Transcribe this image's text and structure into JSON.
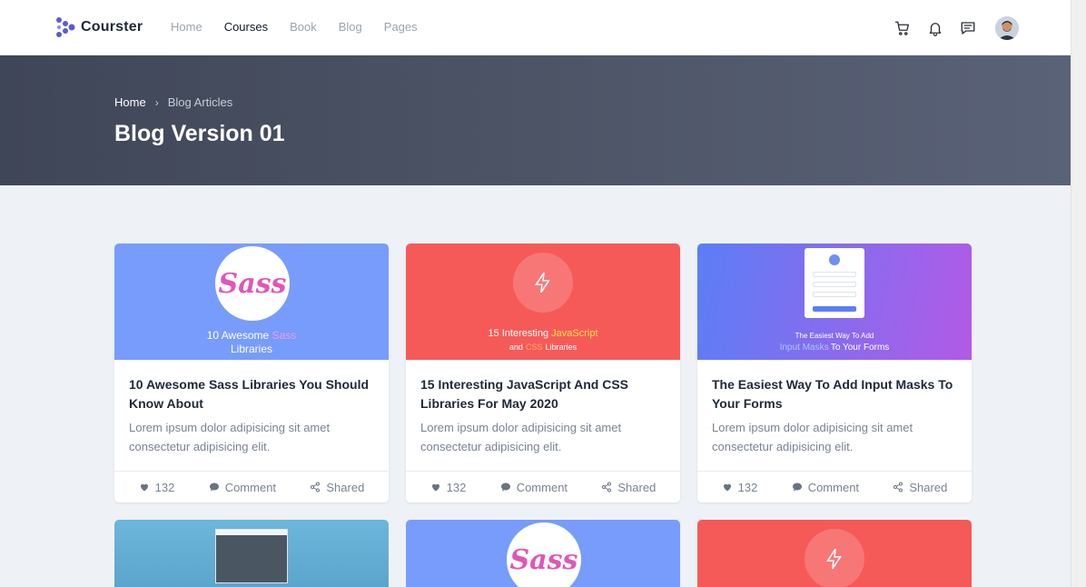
{
  "brand": {
    "name": "Courster"
  },
  "nav": {
    "items": [
      {
        "label": "Home",
        "active": false
      },
      {
        "label": "Courses",
        "active": true
      },
      {
        "label": "Book",
        "active": false
      },
      {
        "label": "Blog",
        "active": false
      },
      {
        "label": "Pages",
        "active": false
      }
    ]
  },
  "header_icons": [
    "cart-icon",
    "bell-icon",
    "chat-icon",
    "avatar"
  ],
  "hero": {
    "breadcrumb": {
      "home": "Home",
      "separator": "›",
      "current": "Blog Articles"
    },
    "title": "Blog Version 01"
  },
  "cards": [
    {
      "thumb": {
        "bg": "#779cfb",
        "badge": "Sass",
        "caption_line1": "10 Awesome",
        "caption_highlight": "Sass",
        "caption_line2": "Libraries"
      },
      "title": "10 Awesome Sass Libraries You Should Know About",
      "desc": "Lorem ipsum dolor adipisicing sit amet consectetur adipisicing elit.",
      "likes": "132",
      "comment": "Comment",
      "shared": "Shared"
    },
    {
      "thumb": {
        "bg": "#f55a58",
        "caption_pre": "15 Interesting",
        "caption_highlight1": "JavaScript",
        "caption_mid": "and",
        "caption_highlight2": "CSS",
        "caption_post": "Libraries"
      },
      "title": "15 Interesting JavaScript And CSS Libraries For May 2020",
      "desc": "Lorem ipsum dolor adipisicing sit amet consectetur adipisicing elit.",
      "likes": "132",
      "comment": "Comment",
      "shared": "Shared"
    },
    {
      "thumb": {
        "bg_from": "#5b7ef6",
        "bg_to": "#b25ae6",
        "caption_line1": "The Easiest Way To Add",
        "caption_highlight": "Input Masks",
        "caption_post": "To Your Forms"
      },
      "title": "The Easiest Way To Add Input Masks To Your Forms",
      "desc": "Lorem ipsum dolor adipisicing sit amet consectetur adipisicing elit.",
      "likes": "132",
      "comment": "Comment",
      "shared": "Shared"
    }
  ],
  "row2": [
    {
      "bg": "#68b2d6"
    },
    {
      "bg": "#779cfb",
      "badge": "Sass"
    },
    {
      "bg": "#f55a58"
    }
  ]
}
